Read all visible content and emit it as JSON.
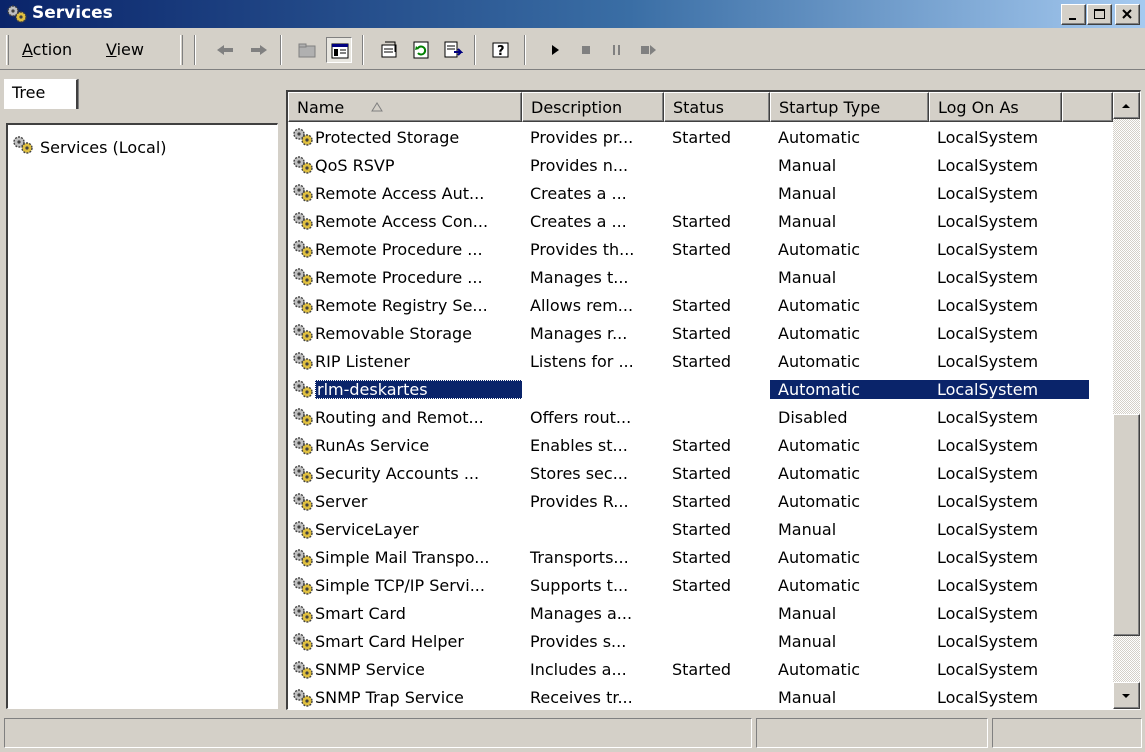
{
  "window": {
    "title": "Services",
    "controls": [
      "minimize",
      "maximize",
      "close"
    ]
  },
  "toolbar": {
    "menu_action": "Action",
    "menu_view": "View",
    "buttons": [
      "back-icon",
      "forward-icon",
      "up-folder-icon",
      "show-hide-tree-icon",
      "properties-icon",
      "refresh-icon",
      "export-list-icon",
      "help-icon",
      "start-service-icon",
      "stop-service-icon",
      "pause-service-icon",
      "restart-service-icon"
    ]
  },
  "tree": {
    "tab_label": "Tree",
    "root_label": "Services (Local)"
  },
  "list": {
    "columns": [
      "Name",
      "Description",
      "Status",
      "Startup Type",
      "Log On As"
    ],
    "sorted_by": "Name",
    "rows": [
      {
        "name": "Protected Storage",
        "description": "Provides pr...",
        "status": "Started",
        "startup": "Automatic",
        "logon": "LocalSystem"
      },
      {
        "name": "QoS RSVP",
        "description": "Provides n...",
        "status": "",
        "startup": "Manual",
        "logon": "LocalSystem"
      },
      {
        "name": "Remote Access Aut...",
        "description": "Creates a ...",
        "status": "",
        "startup": "Manual",
        "logon": "LocalSystem"
      },
      {
        "name": "Remote Access Con...",
        "description": "Creates a ...",
        "status": "Started",
        "startup": "Manual",
        "logon": "LocalSystem"
      },
      {
        "name": "Remote Procedure ...",
        "description": "Provides th...",
        "status": "Started",
        "startup": "Automatic",
        "logon": "LocalSystem"
      },
      {
        "name": "Remote Procedure ...",
        "description": "Manages t...",
        "status": "",
        "startup": "Manual",
        "logon": "LocalSystem"
      },
      {
        "name": "Remote Registry Se...",
        "description": "Allows rem...",
        "status": "Started",
        "startup": "Automatic",
        "logon": "LocalSystem"
      },
      {
        "name": "Removable Storage",
        "description": "Manages r...",
        "status": "Started",
        "startup": "Automatic",
        "logon": "LocalSystem"
      },
      {
        "name": "RIP Listener",
        "description": "Listens for ...",
        "status": "Started",
        "startup": "Automatic",
        "logon": "LocalSystem"
      },
      {
        "name": "rlm-deskartes",
        "description": "",
        "status": "",
        "startup": "Automatic",
        "logon": "LocalSystem",
        "selected": true
      },
      {
        "name": "Routing and Remot...",
        "description": "Offers rout...",
        "status": "",
        "startup": "Disabled",
        "logon": "LocalSystem"
      },
      {
        "name": "RunAs Service",
        "description": "Enables st...",
        "status": "Started",
        "startup": "Automatic",
        "logon": "LocalSystem"
      },
      {
        "name": "Security Accounts ...",
        "description": "Stores sec...",
        "status": "Started",
        "startup": "Automatic",
        "logon": "LocalSystem"
      },
      {
        "name": "Server",
        "description": "Provides R...",
        "status": "Started",
        "startup": "Automatic",
        "logon": "LocalSystem"
      },
      {
        "name": "ServiceLayer",
        "description": "",
        "status": "Started",
        "startup": "Manual",
        "logon": "LocalSystem"
      },
      {
        "name": "Simple Mail Transpo...",
        "description": "Transports...",
        "status": "Started",
        "startup": "Automatic",
        "logon": "LocalSystem"
      },
      {
        "name": "Simple TCP/IP Servi...",
        "description": "Supports t...",
        "status": "Started",
        "startup": "Automatic",
        "logon": "LocalSystem"
      },
      {
        "name": "Smart Card",
        "description": "Manages a...",
        "status": "",
        "startup": "Manual",
        "logon": "LocalSystem"
      },
      {
        "name": "Smart Card Helper",
        "description": "Provides s...",
        "status": "",
        "startup": "Manual",
        "logon": "LocalSystem"
      },
      {
        "name": "SNMP Service",
        "description": "Includes a...",
        "status": "Started",
        "startup": "Automatic",
        "logon": "LocalSystem"
      },
      {
        "name": "SNMP Trap Service",
        "description": "Receives tr...",
        "status": "",
        "startup": "Manual",
        "logon": "LocalSystem"
      }
    ]
  },
  "colors": {
    "titlebar_start": "#0a246a",
    "titlebar_end": "#a6caf0",
    "selection": "#0a246a",
    "face": "#d4d0c8"
  }
}
